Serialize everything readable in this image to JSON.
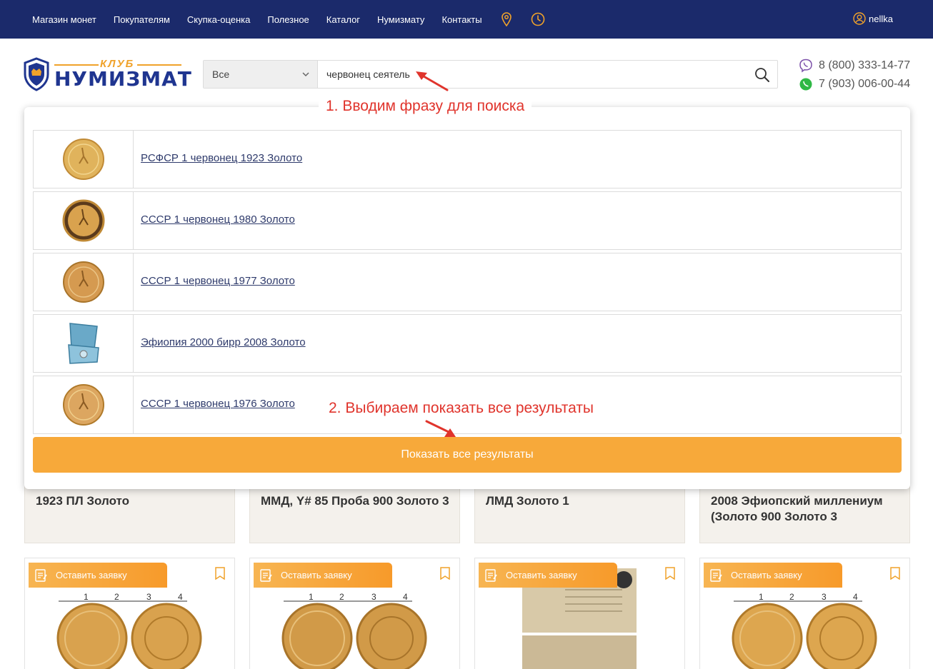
{
  "nav": {
    "items": [
      "Магазин монет",
      "Покупателям",
      "Скупка-оценка",
      "Полезное",
      "Каталог",
      "Нумизмату",
      "Контакты"
    ],
    "user": "nellka"
  },
  "logo": {
    "club": "КЛУБ",
    "name": "НУМИЗМАТ"
  },
  "search": {
    "category": "Все",
    "query": "червонец сеятель"
  },
  "phones": [
    "8 (800) 333-14-77",
    "7 (903) 006-00-44"
  ],
  "annotations": {
    "step1": "1. Вводим фразу для поиска",
    "step2": "2. Выбираем показать все результаты"
  },
  "results": [
    {
      "title": "РСФСР 1 червонец 1923 Золото",
      "thumb": "gold-coin"
    },
    {
      "title": "СССР 1 червонец 1980 Золото",
      "thumb": "gold-coin-dark"
    },
    {
      "title": "СССР 1 червонец 1977 Золото",
      "thumb": "gold-coin"
    },
    {
      "title": "Эфиопия 2000 бирр 2008 Золото",
      "thumb": "coin-box"
    },
    {
      "title": "СССР 1 червонец 1976 Золото",
      "thumb": "gold-coin"
    }
  ],
  "show_all_label": "Показать все результаты",
  "cards": [
    {
      "title": "1923 ПЛ Золото"
    },
    {
      "title": "ММД, Y# 85 Проба 900 Золото 3"
    },
    {
      "title": "ЛМД Золото 1"
    },
    {
      "title": "2008 Эфиопский миллениум (Золото 900 Золото 3"
    }
  ],
  "product_cards": [
    {
      "badge": "Оставить заявку"
    },
    {
      "badge": "Оставить заявку"
    },
    {
      "badge": "Оставить заявку"
    },
    {
      "badge": "Оставить заявку"
    }
  ],
  "colors": {
    "nav_bg": "#1b2a6b",
    "accent": "#f7a93a",
    "annotation": "#e0342c"
  }
}
